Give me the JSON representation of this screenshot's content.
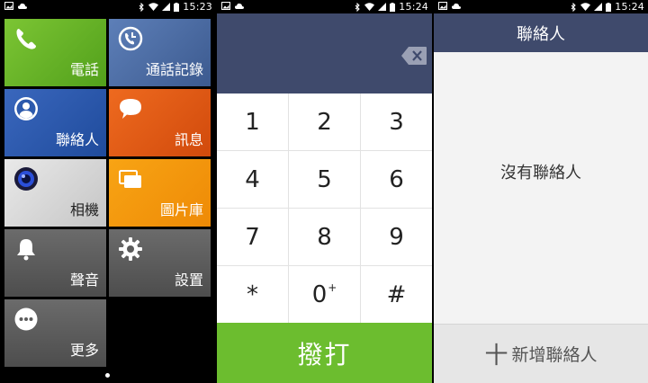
{
  "screens": [
    {
      "status": {
        "time": "15:23"
      }
    },
    {
      "status": {
        "time": "15:24"
      }
    },
    {
      "status": {
        "time": "15:24"
      }
    }
  ],
  "launcher": {
    "tiles": [
      {
        "label": "電話",
        "icon": "phone-icon"
      },
      {
        "label": "通話記錄",
        "icon": "call-log-icon"
      },
      {
        "label": "聯絡人",
        "icon": "contact-person-icon"
      },
      {
        "label": "訊息",
        "icon": "message-bubble-icon"
      },
      {
        "label": "相機",
        "icon": "camera-lens-icon"
      },
      {
        "label": "圖片庫",
        "icon": "gallery-icon"
      },
      {
        "label": "聲音",
        "icon": "bell-icon"
      },
      {
        "label": "設置",
        "icon": "gear-icon"
      },
      {
        "label": "更多",
        "icon": "more-dots-icon"
      }
    ]
  },
  "dialer": {
    "keys": [
      "1",
      "2",
      "3",
      "4",
      "5",
      "6",
      "7",
      "8",
      "9",
      "*",
      "0",
      "#"
    ],
    "zero_sup": "+",
    "call_label": "撥打"
  },
  "contacts": {
    "title": "聯絡人",
    "empty_message": "沒有聯絡人",
    "add_plus": "十",
    "add_label": "新增聯絡人"
  },
  "colors": {
    "header": "#3f4a6c",
    "call_green": "#6cbd2f",
    "phone_tile": "#6ab42a",
    "calllog_tile": "#4d6ea5",
    "contacts_tile": "#2d5aad",
    "message_tile": "#e05a15",
    "gallery_tile": "#f39a0c"
  }
}
